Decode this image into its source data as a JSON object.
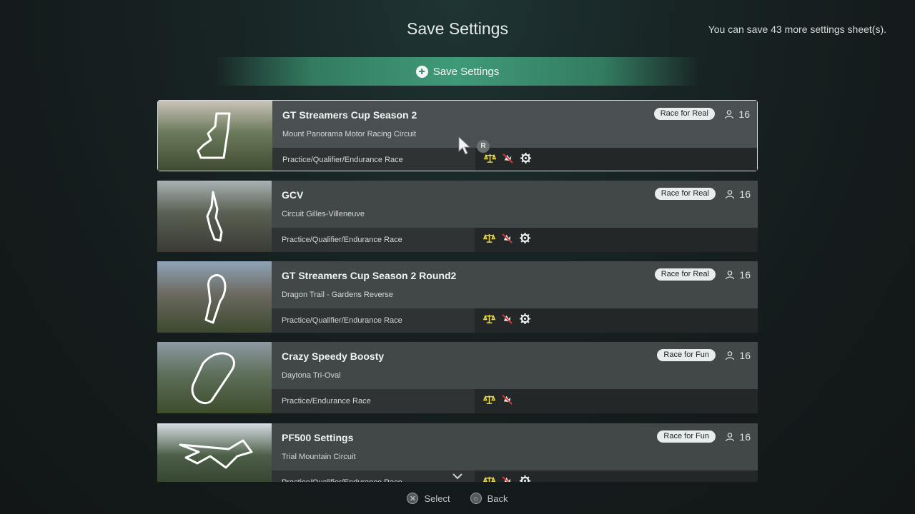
{
  "header": {
    "title": "Save Settings",
    "remaining_text": "You can save 43 more settings sheet(s)."
  },
  "save_button": {
    "label": "Save Settings",
    "icon": "plus-circle-icon"
  },
  "cards": [
    {
      "name": "GT Streamers Cup Season 2",
      "track": "Mount Panorama Motor Racing Circuit",
      "race_types": "Practice/Qualifier/Endurance Race",
      "badge": "Race for Real",
      "players": "16",
      "icons": [
        "balance-icon",
        "no-collision-icon",
        "gear-icon"
      ],
      "selected": true
    },
    {
      "name": "GCV",
      "track": "Circuit Gilles-Villeneuve",
      "race_types": "Practice/Qualifier/Endurance Race",
      "badge": "Race for Real",
      "players": "16",
      "icons": [
        "balance-icon",
        "no-collision-icon",
        "gear-icon"
      ],
      "selected": false
    },
    {
      "name": "GT Streamers Cup Season 2 Round2",
      "track": "Dragon Trail - Gardens Reverse",
      "race_types": "Practice/Qualifier/Endurance Race",
      "badge": "Race for Real",
      "players": "16",
      "icons": [
        "balance-icon",
        "no-collision-icon",
        "gear-icon"
      ],
      "selected": false
    },
    {
      "name": "Crazy Speedy Boosty",
      "track": "Daytona Tri-Oval",
      "race_types": "Practice/Endurance Race",
      "badge": "Race for Fun",
      "players": "16",
      "icons": [
        "balance-icon",
        "no-collision-icon"
      ],
      "selected": false
    },
    {
      "name": "PF500 Settings",
      "track": "Trial Mountain Circuit",
      "race_types": "Practice/Qualifier/Endurance Race",
      "badge": "Race for Fun",
      "players": "16",
      "icons": [
        "balance-icon",
        "no-collision-icon",
        "gear-icon"
      ],
      "selected": false
    }
  ],
  "cursor_badge": "R",
  "footer": {
    "select_label": "Select",
    "select_icon": "cross-button-icon",
    "back_label": "Back",
    "back_icon": "circle-button-icon"
  },
  "colors": {
    "accent_green": "#3f9a78",
    "balance_icon": "#e8d84a",
    "no_collision": "#d93a3a"
  }
}
